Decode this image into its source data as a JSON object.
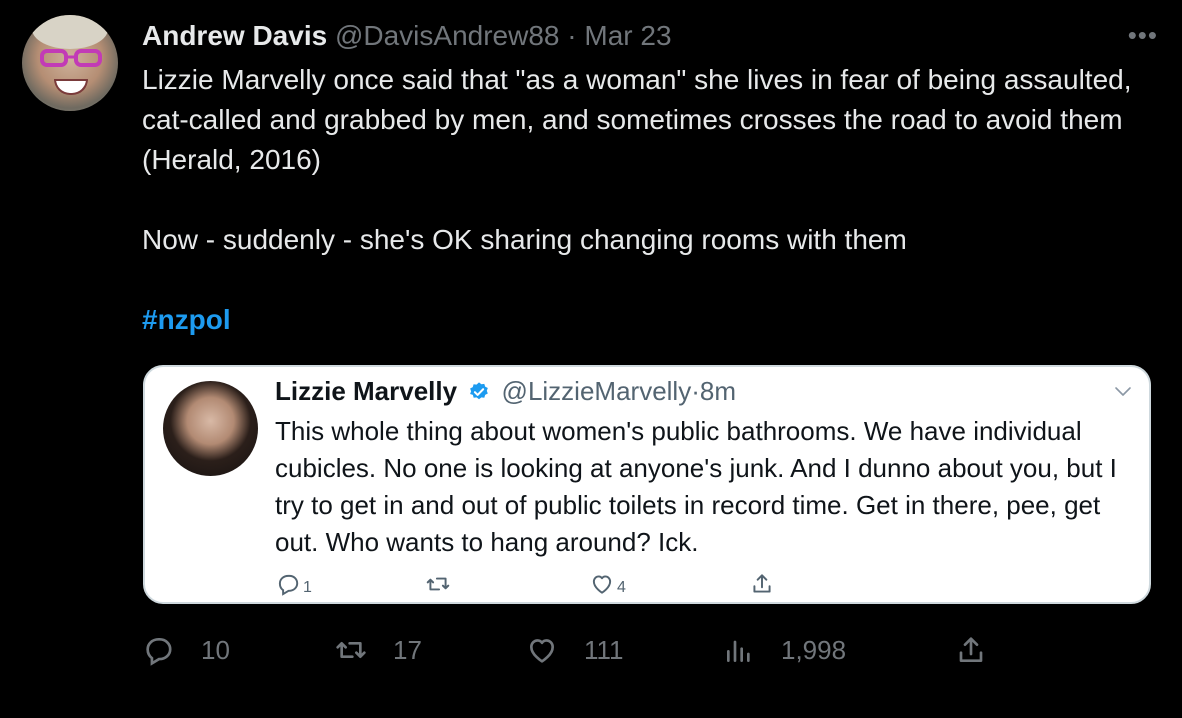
{
  "tweet": {
    "author_name": "Andrew Davis",
    "handle": "@DavisAndrew88",
    "separator": "·",
    "date": "Mar 23",
    "more_label": "•••",
    "text_lines": [
      "Lizzie Marvelly once said that \"as a woman\" she lives in fear of being assaulted, cat-called and grabbed by men, and sometimes crosses the road to avoid them (Herald, 2016)",
      "Now - suddenly - she's OK sharing changing rooms with them"
    ],
    "hashtag": "#nzpol"
  },
  "quote": {
    "author_name": "Lizzie Marvelly",
    "handle": "@LizzieMarvelly",
    "separator": "·",
    "time": "8m",
    "text": "This whole thing about women's public bathrooms. We have individual cubicles. No one is looking at anyone's junk. And I dunno about you, but I try to get in and out of public toilets in record time. Get in there, pee, get out. Who wants to hang around? Ick.",
    "replies": "1",
    "likes": "4"
  },
  "actions": {
    "replies": "10",
    "retweets": "17",
    "likes": "111",
    "views": "1,998"
  },
  "colors": {
    "background": "#000000",
    "text": "#e7e9ea",
    "muted": "#71767b",
    "accent": "#1d9bf0",
    "card": "#ffffff"
  }
}
